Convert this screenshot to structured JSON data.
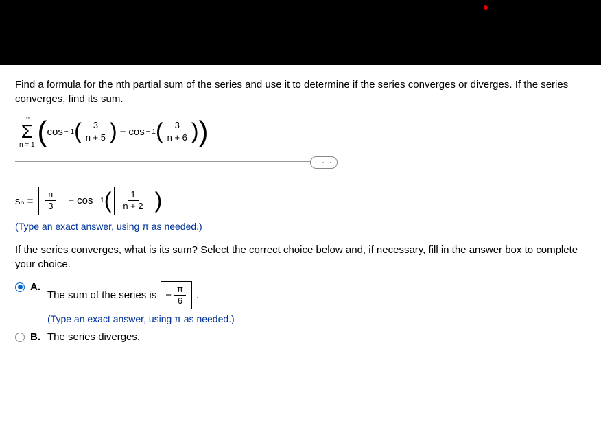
{
  "question": {
    "prompt": "Find a formula for the nth partial sum of the series and use it to determine if the series converges or diverges. If the series converges, find its sum.",
    "sigma_top": "∞",
    "sigma_bottom": "n = 1",
    "cos_label": "cos",
    "exp_sup": "− 1",
    "frac1_num": "3",
    "frac1_den": "n + 5",
    "frac2_num": "3",
    "frac2_den": "n + 6"
  },
  "sn": {
    "label": "sₙ =",
    "box1_num": "π",
    "box1_den": "3",
    "minus": "−",
    "cos_label": "cos",
    "exp_sup": "− 1",
    "frac_num": "1",
    "frac_den": "n + 2",
    "instruction": "(Type an exact answer, using π as needed.)"
  },
  "subq": "If the series converges, what is its sum? Select the correct choice below and, if necessary, fill in the answer box to complete your choice.",
  "choiceA": {
    "label": "A.",
    "text": "The sum of the series is",
    "neg": "−",
    "ans_num": "π",
    "ans_den": "6",
    "period": ".",
    "instruction": "(Type an exact answer, using π as needed.)"
  },
  "choiceB": {
    "label": "B.",
    "text": "The series diverges."
  },
  "ellipsis": "· · ·"
}
